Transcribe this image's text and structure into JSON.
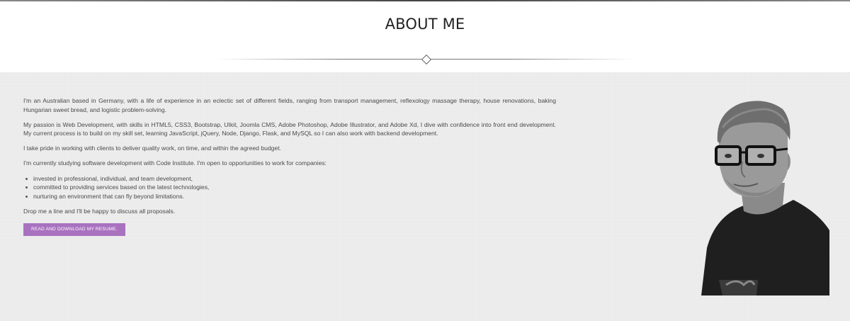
{
  "header": {
    "title": "ABOUT ME"
  },
  "about": {
    "paragraphs": [
      "I'm an Australian based in Germany, with a life of experience in an eclectic set of different fields, ranging from transport management, reflexology massage therapy, house renovations, baking Hungarian sweet bread, and logistic problem-solving.",
      "My passion is Web Development, with skills in HTML5, CSS3, Bootstrap, UIkit, Joomla CMS, Adobe Photoshop, Adobe Illustrator, and Adobe Xd, I dive with confidence into front end development. My current process is to build on my skill set, learning JavaScript, jQuery, Node, Django, Flask, and MySQL so I can also work with backend development.",
      "I take pride in working with clients to deliver quality work, on time, and within the agreed budget.",
      "I'm currently studying software development with Code Institute. I'm open to opportunities to work for companies:"
    ],
    "bullets": [
      "invested in professional, individual, and team development,",
      "committed to providing services based on the latest technologies,",
      "nurturing an environment that can fly beyond limitations."
    ],
    "closing": "Drop me a line and I'll be happy to discuss all proposals.",
    "button_label": "READ AND DOWNLOAD MY RESUME.",
    "button_color": "#a972bf"
  },
  "icons": {
    "divider": "diamond-icon"
  }
}
